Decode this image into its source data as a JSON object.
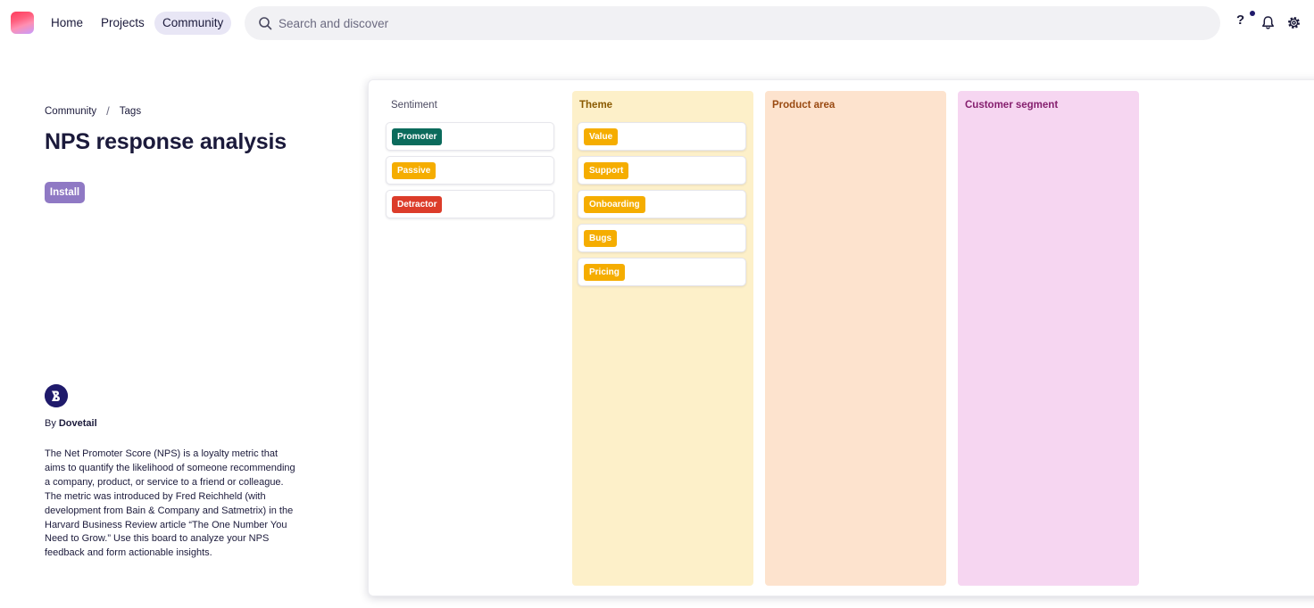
{
  "nav": {
    "home": "Home",
    "projects": "Projects",
    "community": "Community"
  },
  "search": {
    "placeholder": "Search and discover",
    "value": ""
  },
  "header_icons": {
    "help": "?",
    "help_icon": "question-icon",
    "notifications_icon": "bell-icon",
    "settings_icon": "gear-icon"
  },
  "breadcrumb": {
    "items": [
      "Community",
      "Tags"
    ],
    "separator": "/"
  },
  "page": {
    "title": "NPS response analysis",
    "install_label": "Install"
  },
  "author": {
    "by_label": "By",
    "name": "Dovetail"
  },
  "description": "The Net Promoter Score (NPS) is a loyalty metric that aims to quantify the likelihood of someone recommending a company, product, or service to a friend or colleague. The metric was introduced by Fred Reichheld (with development from Bain & Company and Satmetrix) in the Harvard Business Review article “The One Number You Need to Grow.” Use this board to analyze your NPS feedback and form actionable insights.",
  "board": {
    "columns": [
      {
        "title": "Sentiment",
        "color": "#ffffff",
        "tags": [
          {
            "label": "Promoter",
            "color": "#0b6b5c"
          },
          {
            "label": "Passive",
            "color": "#f5ad00"
          },
          {
            "label": "Detractor",
            "color": "#dc3c2a"
          }
        ]
      },
      {
        "title": "Theme",
        "color": "#fdf0c9",
        "tags": [
          {
            "label": "Value",
            "color": "#f5ad00"
          },
          {
            "label": "Support",
            "color": "#f5ad00"
          },
          {
            "label": "Onboarding",
            "color": "#f5ad00"
          },
          {
            "label": "Bugs",
            "color": "#f5ad00"
          },
          {
            "label": "Pricing",
            "color": "#f5ad00"
          }
        ]
      },
      {
        "title": "Product area",
        "color": "#fde3ce",
        "tags": []
      },
      {
        "title": "Customer segment",
        "color": "#f6d6f1",
        "tags": []
      }
    ]
  },
  "colors": {
    "accent": "#1f1a6b",
    "install_button": "#8f79c4",
    "nav_active": "#e8e6f5"
  }
}
